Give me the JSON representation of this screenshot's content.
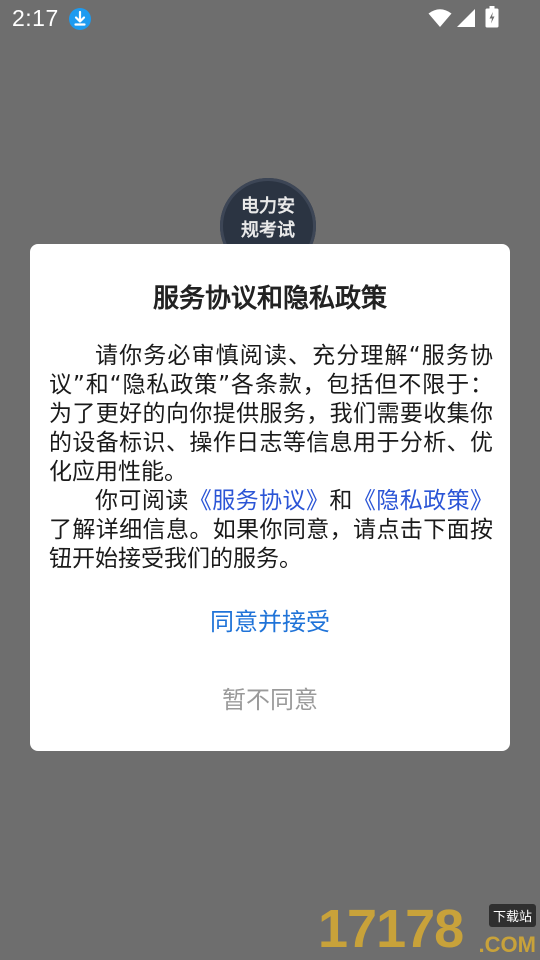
{
  "status_bar": {
    "time": "2:17",
    "icons": [
      "download-notification-icon",
      "wifi-icon",
      "signal-icon",
      "battery-charging-icon"
    ]
  },
  "app_logo": {
    "line1": "电力安",
    "line2": "规考试"
  },
  "dialog": {
    "title": "服务协议和隐私政策",
    "paragraph1": "请你务必审慎阅读、充分理解“服务协议”和“隐私政策”各条款，包括但不限于：为了更好的向你提供服务，我们需要收集你的设备标识、操作日志等信息用于分析、优化应用性能。",
    "paragraph2_prefix": "你可阅读",
    "service_link": "《服务协议》",
    "paragraph2_middle": "和",
    "privacy_link": "《隐私政策》",
    "paragraph2_suffix": "了解详细信息。如果你同意，请点击下面按钮开始接受我们的服务。",
    "agree_label": "同意并接受",
    "disagree_label": "暂不同意"
  },
  "watermark": {
    "digits": "17178",
    "tag": "下载站",
    "domain": ".COM"
  },
  "colors": {
    "overlay": "#6e6e6e",
    "link": "#2b55d6",
    "agree": "#1f73d8",
    "disagree": "#9a9a9a"
  }
}
